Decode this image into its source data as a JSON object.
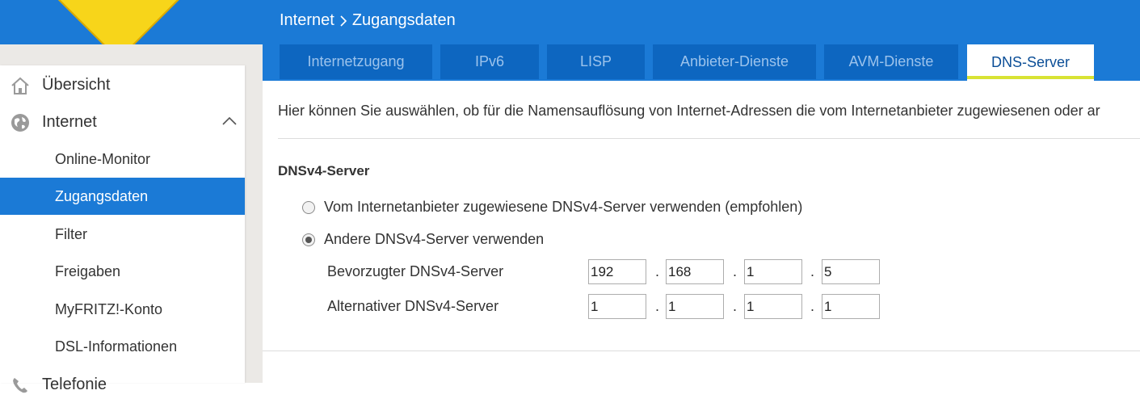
{
  "header": {
    "breadcrumb_root": "Internet",
    "breadcrumb_separator": ">",
    "breadcrumb_current": "Zugangsdaten"
  },
  "tabs": [
    {
      "label": "Internetzugang",
      "active": false
    },
    {
      "label": "IPv6",
      "active": false
    },
    {
      "label": "LISP",
      "active": false
    },
    {
      "label": "Anbieter-Dienste",
      "active": false
    },
    {
      "label": "AVM-Dienste",
      "active": false
    },
    {
      "label": "DNS-Server",
      "active": true
    }
  ],
  "sidebar": {
    "items": [
      {
        "label": "Übersicht",
        "icon": "home-icon"
      },
      {
        "label": "Internet",
        "icon": "globe-icon",
        "expanded": true
      },
      {
        "label": "Online-Monitor"
      },
      {
        "label": "Zugangsdaten",
        "active": true
      },
      {
        "label": "Filter"
      },
      {
        "label": "Freigaben"
      },
      {
        "label": "MyFRITZ!-Konto"
      },
      {
        "label": "DSL-Informationen"
      },
      {
        "label": "Telefonie",
        "icon": "phone-icon"
      }
    ]
  },
  "main": {
    "intro": "Hier können Sie auswählen, ob für die Namensauflösung von Internet-Adressen die vom Internetanbieter zugewiesenen oder ar",
    "section_title": "DNSv4-Server",
    "option_provider": "Vom Internetanbieter zugewiesene DNSv4-Server verwenden (empfohlen)",
    "option_custom": "Andere DNSv4-Server verwenden",
    "preferred_label": "Bevorzugter DNSv4-Server",
    "alternative_label": "Alternativer DNSv4-Server",
    "preferred_ip": [
      "192",
      "168",
      "1",
      "5"
    ],
    "alternative_ip": [
      "1",
      "1",
      "1",
      "1"
    ],
    "ip_separator": "."
  },
  "colors": {
    "brand_blue": "#1b7ad6",
    "tab_blue": "#0d66c0",
    "active_underline": "#d8e334"
  }
}
